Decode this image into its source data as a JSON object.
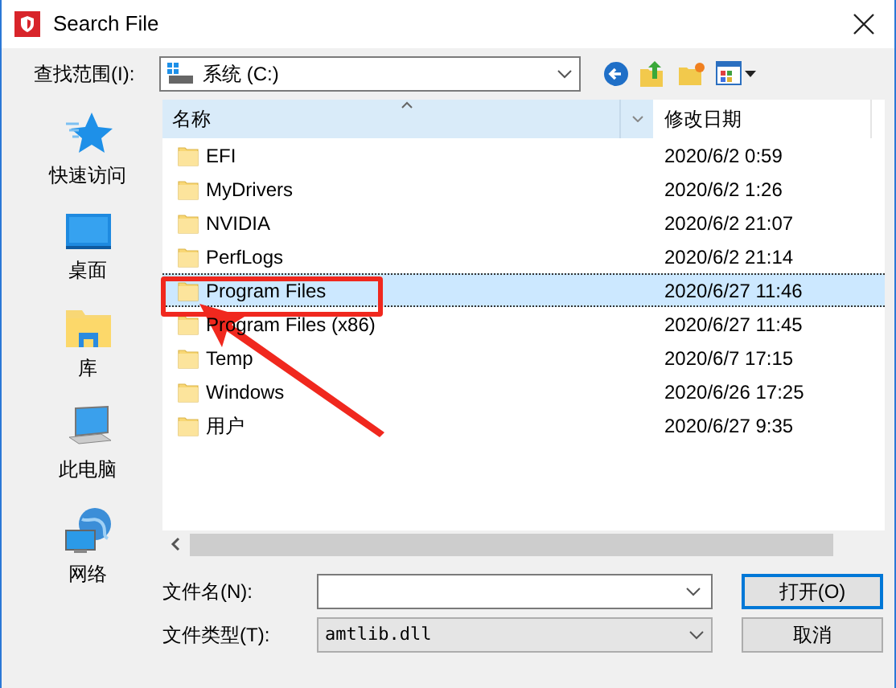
{
  "window": {
    "title": "Search File"
  },
  "look_in": {
    "label": "查找范围(I):",
    "value": "系统 (C:)"
  },
  "sidebar": {
    "items": [
      {
        "label": "快速访问",
        "kind": "star"
      },
      {
        "label": "桌面",
        "kind": "desktop"
      },
      {
        "label": "库",
        "kind": "library"
      },
      {
        "label": "此电脑",
        "kind": "computer"
      },
      {
        "label": "网络",
        "kind": "network"
      }
    ]
  },
  "table": {
    "columns": [
      "名称",
      "修改日期"
    ],
    "rows": [
      {
        "name": "EFI",
        "date": "2020/6/2 0:59",
        "selected": false
      },
      {
        "name": "MyDrivers",
        "date": "2020/6/2 1:26",
        "selected": false
      },
      {
        "name": "NVIDIA",
        "date": "2020/6/2 21:07",
        "selected": false
      },
      {
        "name": "PerfLogs",
        "date": "2020/6/2 21:14",
        "selected": false
      },
      {
        "name": "Program Files",
        "date": "2020/6/27 11:46",
        "selected": true
      },
      {
        "name": "Program Files (x86)",
        "date": "2020/6/27 11:45",
        "selected": false
      },
      {
        "name": "Temp",
        "date": "2020/6/7 17:15",
        "selected": false
      },
      {
        "name": "Windows",
        "date": "2020/6/26 17:25",
        "selected": false
      },
      {
        "name": "用户",
        "date": "2020/6/27 9:35",
        "selected": false
      }
    ]
  },
  "file_name": {
    "label": "文件名(N):"
  },
  "file_type": {
    "label": "文件类型(T):",
    "value": "amtlib.dll"
  },
  "buttons": [
    {
      "label": "打开(O)",
      "default": true
    },
    {
      "label": "取消",
      "default": false
    }
  ]
}
